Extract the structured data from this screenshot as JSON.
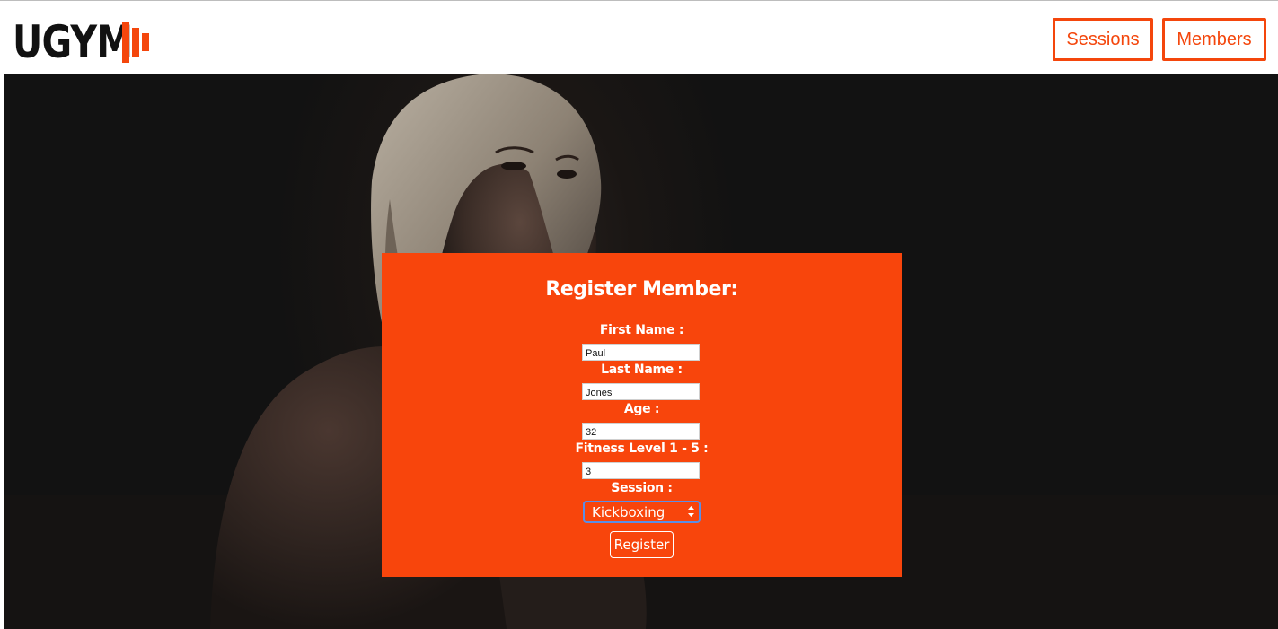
{
  "header": {
    "logo_text": "UGYM",
    "nav": [
      {
        "label": "Sessions"
      },
      {
        "label": "Members"
      }
    ]
  },
  "colors": {
    "accent": "#f8450c",
    "header_bg": "#ffffff",
    "hero_bg": "#141414"
  },
  "form": {
    "title": "Register Member:",
    "fields": [
      {
        "label": "First Name :",
        "value": "Paul"
      },
      {
        "label": "Last Name :",
        "value": "Jones"
      },
      {
        "label": "Age :",
        "value": "32"
      },
      {
        "label": "Fitness Level 1 - 5 :",
        "value": "3"
      }
    ],
    "session": {
      "label": "Session :",
      "selected": "Kickboxing",
      "icon": "select-arrows-icon"
    },
    "submit_label": "Register"
  }
}
